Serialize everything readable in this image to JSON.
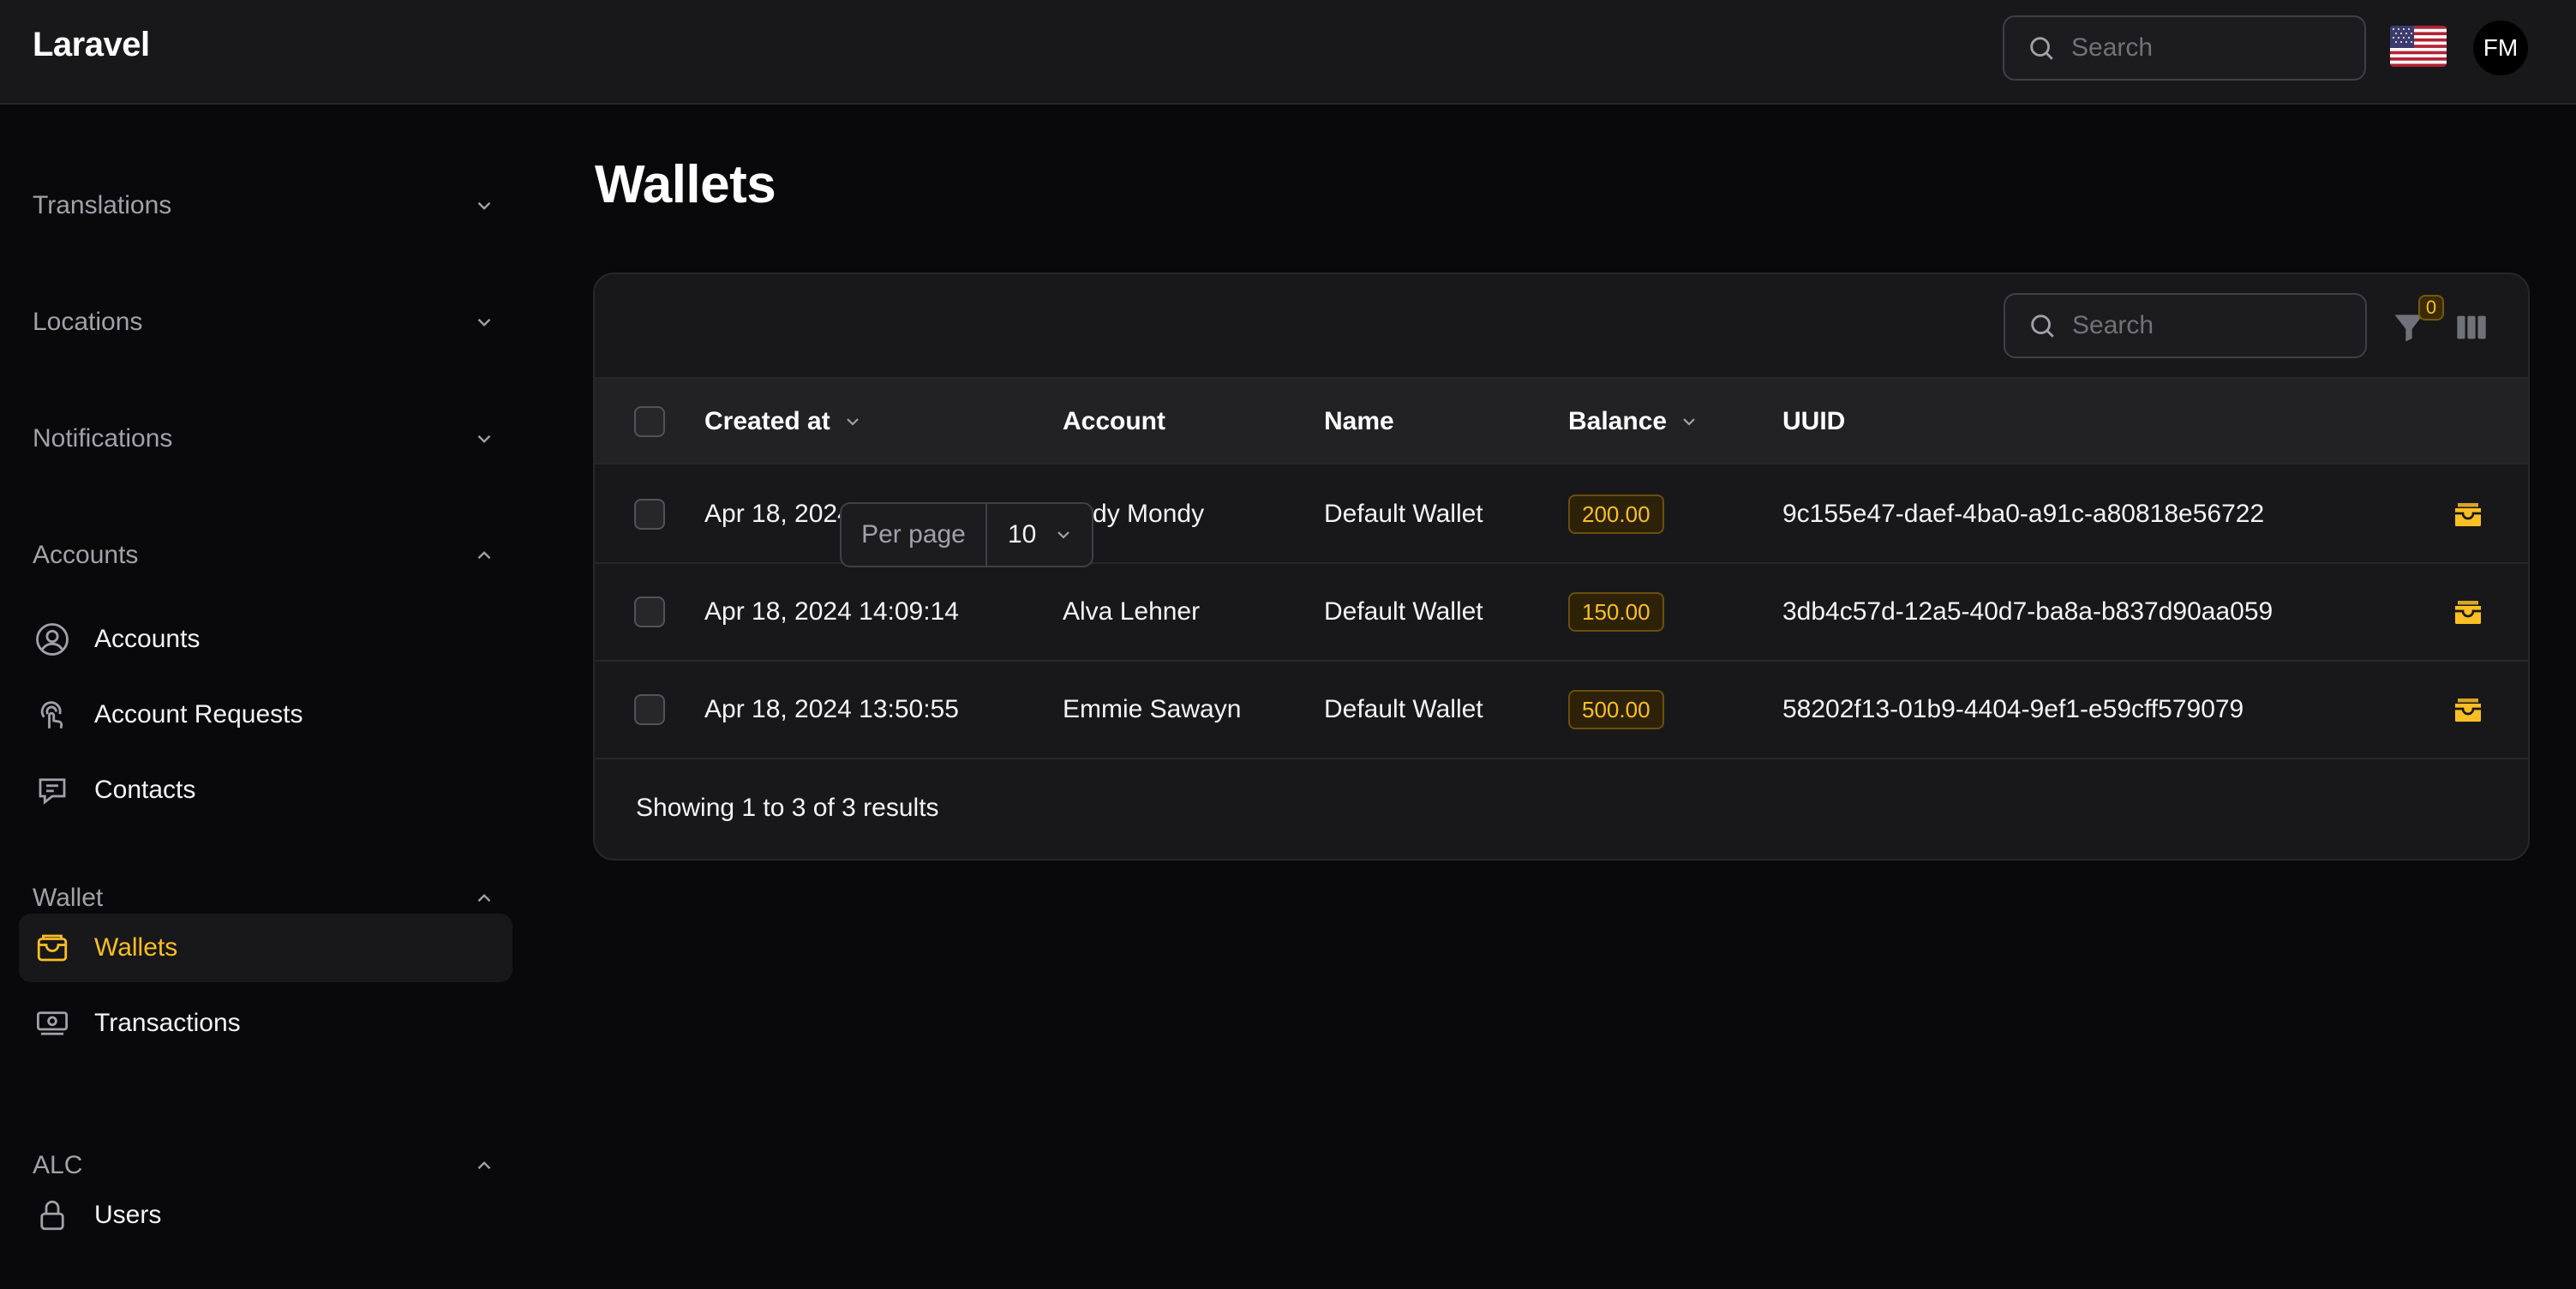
{
  "app": {
    "brand": "Laravel"
  },
  "topbar": {
    "search": {
      "placeholder": "Search",
      "value": ""
    },
    "flag_icon": "us-flag-icon",
    "avatar_initials": "FM"
  },
  "sidebar": {
    "groups": [
      {
        "label": "Translations",
        "expanded": false,
        "items": []
      },
      {
        "label": "Locations",
        "expanded": false,
        "items": []
      },
      {
        "label": "Notifications",
        "expanded": false,
        "items": []
      },
      {
        "label": "Accounts",
        "expanded": true,
        "items": [
          {
            "label": "Accounts",
            "icon": "user-circle-icon"
          },
          {
            "label": "Account Requests",
            "icon": "cursor-click-icon"
          },
          {
            "label": "Contacts",
            "icon": "chat-bubble-icon"
          }
        ]
      },
      {
        "label": "Wallet",
        "expanded": true,
        "items": [
          {
            "label": "Wallets",
            "icon": "wallet-icon",
            "active": true
          },
          {
            "label": "Transactions",
            "icon": "banknotes-icon"
          }
        ]
      },
      {
        "label": "ALC",
        "expanded": true,
        "items": [
          {
            "label": "Users",
            "icon": "lock-icon"
          }
        ]
      }
    ]
  },
  "main": {
    "title": "Wallets",
    "table": {
      "search": {
        "placeholder": "Search",
        "value": ""
      },
      "filter_count": "0",
      "columns": [
        {
          "label": "Created at",
          "sortable": true
        },
        {
          "label": "Account",
          "sortable": false
        },
        {
          "label": "Name",
          "sortable": false
        },
        {
          "label": "Balance",
          "sortable": true
        },
        {
          "label": "UUID",
          "sortable": false
        }
      ],
      "rows": [
        {
          "created_at": "Apr 18, 2024 14:09:19",
          "account": "Fady Mondy",
          "name": "Default Wallet",
          "balance": "200.00",
          "uuid": "9c155e47-daef-4ba0-a91c-a80818e56722"
        },
        {
          "created_at": "Apr 18, 2024 14:09:14",
          "account": "Alva Lehner",
          "name": "Default Wallet",
          "balance": "150.00",
          "uuid": "3db4c57d-12a5-40d7-ba8a-b837d90aa059"
        },
        {
          "created_at": "Apr 18, 2024 13:50:55",
          "account": "Emmie Sawayn",
          "name": "Default Wallet",
          "balance": "500.00",
          "uuid": "58202f13-01b9-4404-9ef1-e59cff579079"
        }
      ],
      "results_text": "Showing 1 to 3 of 3 results",
      "per_page": {
        "label": "Per page",
        "value": "10"
      }
    }
  },
  "colors": {
    "accent": "#fbbf24",
    "background": "#09090b",
    "surface": "#18181b"
  }
}
